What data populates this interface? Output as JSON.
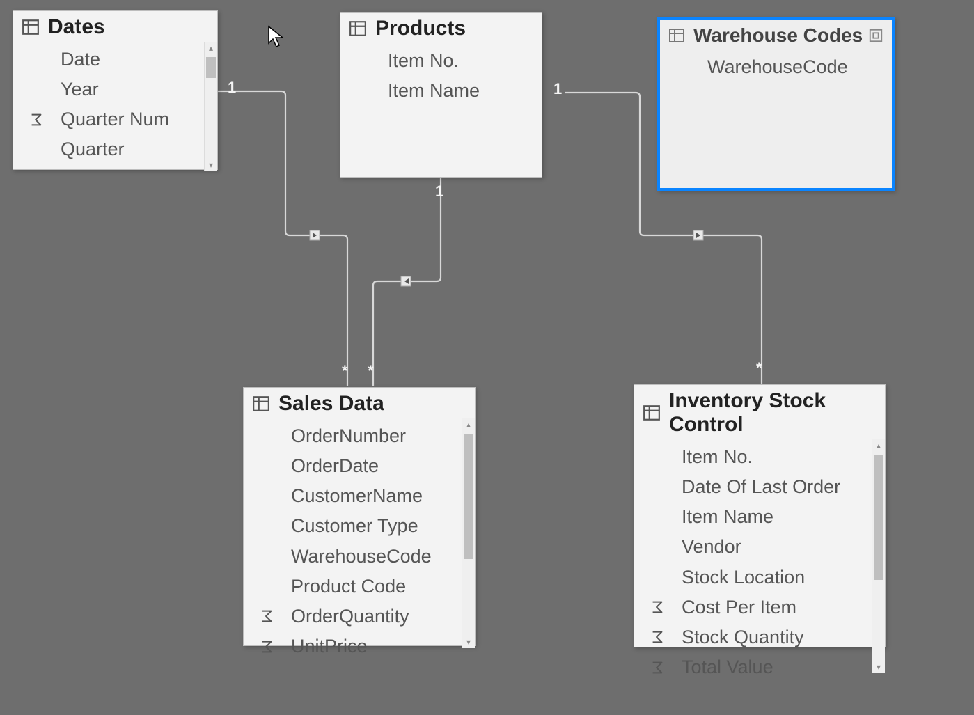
{
  "tables": {
    "dates": {
      "title": "Dates",
      "fields": [
        {
          "label": "Date",
          "agg": false
        },
        {
          "label": "Year",
          "agg": false
        },
        {
          "label": "Quarter Num",
          "agg": true
        },
        {
          "label": "Quarter",
          "agg": false
        }
      ]
    },
    "products": {
      "title": "Products",
      "fields": [
        {
          "label": "Item No.",
          "agg": false
        },
        {
          "label": "Item Name",
          "agg": false
        }
      ]
    },
    "warehouse": {
      "title": "Warehouse Codes",
      "fields": [
        {
          "label": "WarehouseCode",
          "agg": false
        }
      ]
    },
    "sales": {
      "title": "Sales Data",
      "fields": [
        {
          "label": "OrderNumber",
          "agg": false
        },
        {
          "label": "OrderDate",
          "agg": false
        },
        {
          "label": "CustomerName",
          "agg": false
        },
        {
          "label": "Customer Type",
          "agg": false
        },
        {
          "label": "WarehouseCode",
          "agg": false
        },
        {
          "label": "Product Code",
          "agg": false
        },
        {
          "label": "OrderQuantity",
          "agg": true
        },
        {
          "label": "UnitPrice",
          "agg": true
        }
      ]
    },
    "inventory": {
      "title": "Inventory Stock Control",
      "fields": [
        {
          "label": "Item No.",
          "agg": false
        },
        {
          "label": "Date Of Last Order",
          "agg": false
        },
        {
          "label": "Item Name",
          "agg": false
        },
        {
          "label": "Vendor",
          "agg": false
        },
        {
          "label": "Stock Location",
          "agg": false
        },
        {
          "label": "Cost Per Item",
          "agg": true
        },
        {
          "label": "Stock Quantity",
          "agg": true
        },
        {
          "label": "Total Value",
          "agg": true
        }
      ]
    }
  },
  "relationships": [
    {
      "from": "dates",
      "to": "sales",
      "from_card": "1",
      "to_card": "*"
    },
    {
      "from": "products",
      "to": "sales",
      "from_card": "1",
      "to_card": "*"
    },
    {
      "from": "warehouse",
      "to": "inventory",
      "from_card": "1",
      "to_card": "*"
    }
  ],
  "selected_table": "warehouse"
}
